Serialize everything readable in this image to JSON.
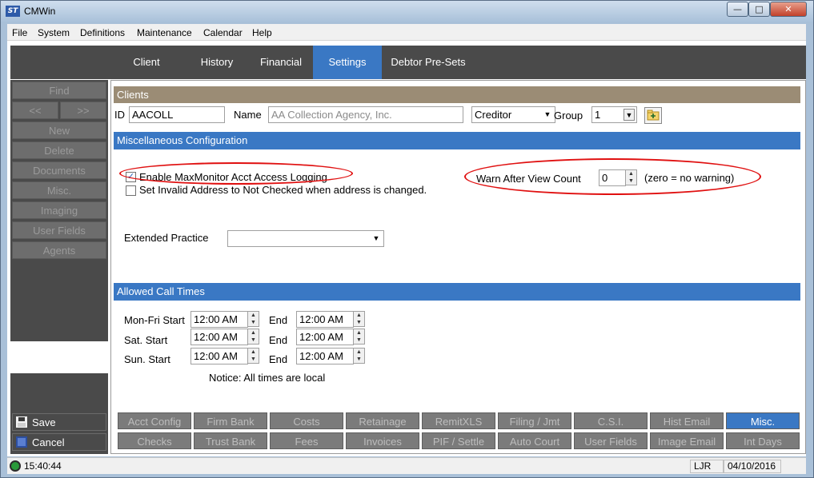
{
  "window": {
    "title": "CMWin",
    "icon_text": "ST"
  },
  "menu": [
    "File",
    "System",
    "Definitions",
    "Maintenance",
    "Calendar",
    "Help"
  ],
  "tabs": [
    "Client",
    "History",
    "Financial",
    "Settings",
    "Debtor Pre-Sets"
  ],
  "active_tab": "Settings",
  "nav": {
    "find": "Find",
    "prev": "<<",
    "next": ">>",
    "items": [
      "New",
      "Delete",
      "Documents",
      "Misc.",
      "Imaging",
      "User Fields",
      "Agents"
    ],
    "save": "Save",
    "cancel": "Cancel"
  },
  "clients": {
    "header": "Clients",
    "id_label": "ID",
    "id_value": "AACOLL",
    "name_label": "Name",
    "name_value": "AA Collection Agency, Inc.",
    "type_value": "Creditor",
    "group_label": "Group",
    "group_value": "1"
  },
  "misc_config": {
    "header": "Miscellaneous Configuration",
    "enable_logging_label": "Enable MaxMonitor Acct Access Logging",
    "enable_logging_checked": true,
    "set_invalid_label": "Set Invalid Address to Not Checked when address is changed.",
    "set_invalid_checked": false,
    "warn_label": "Warn After View Count",
    "warn_value": "0",
    "warn_note": "(zero = no warning)",
    "extended_practice_label": "Extended Practice",
    "extended_practice_value": ""
  },
  "call_times": {
    "header": "Allowed Call Times",
    "rows": [
      {
        "label": "Mon-Fri Start",
        "start": "12:00 AM",
        "end_label": "End",
        "end": "12:00 AM"
      },
      {
        "label": "Sat. Start",
        "start": "12:00 AM",
        "end_label": "End",
        "end": "12:00 AM"
      },
      {
        "label": "Sun. Start",
        "start": "12:00 AM",
        "end_label": "End",
        "end": "12:00 AM"
      }
    ],
    "notice": "Notice: All times are local"
  },
  "bottom_buttons": {
    "row1": [
      "Acct Config",
      "Firm Bank",
      "Costs",
      "Retainage",
      "RemitXLS",
      "Filing / Jmt",
      "C.S.I.",
      "Hist Email",
      "Misc."
    ],
    "row2": [
      "Checks",
      "Trust Bank",
      "Fees",
      "Invoices",
      "PIF / Settle",
      "Auto Court",
      "User Fields",
      "Image Email",
      "Int Days"
    ],
    "active": "Misc."
  },
  "status": {
    "time": "15:40:44",
    "user": "LJR",
    "date": "04/10/2016"
  }
}
